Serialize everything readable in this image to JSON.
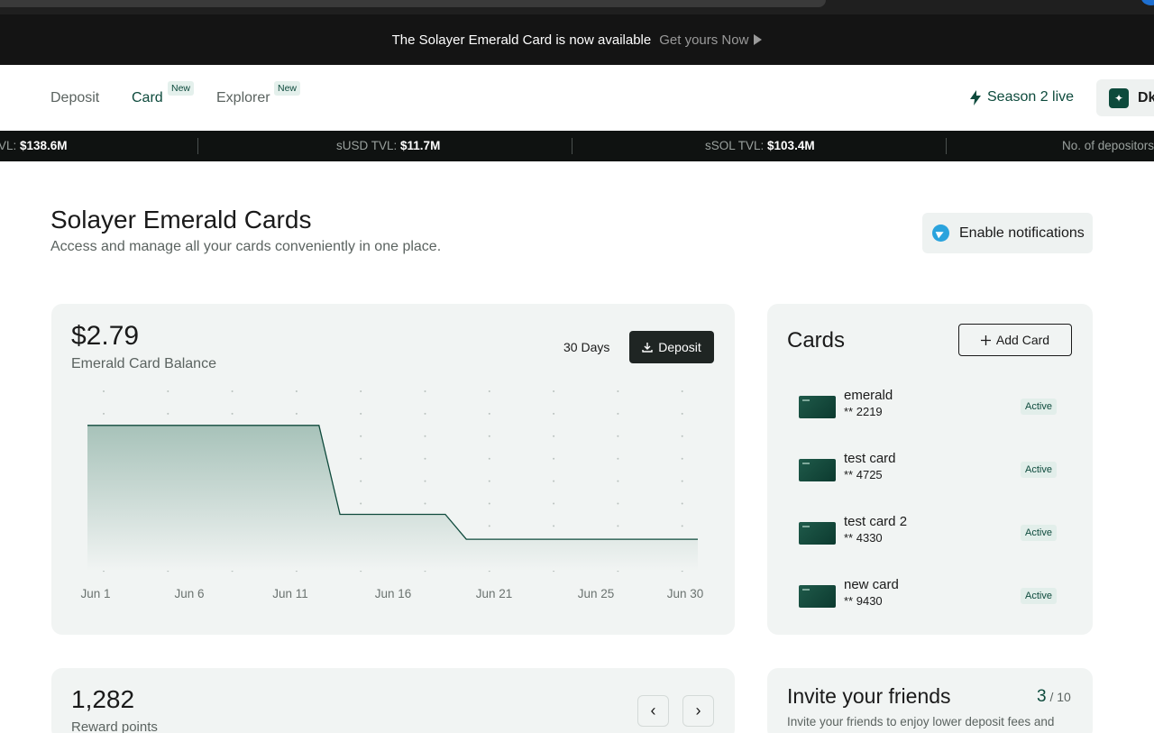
{
  "announcement": {
    "message": "The Solayer Emerald Card is now available",
    "link": "Get yours Now"
  },
  "nav": {
    "items": [
      {
        "label": "Deposit",
        "badge": ""
      },
      {
        "label": "Card",
        "badge": "New"
      },
      {
        "label": "Explorer",
        "badge": "New"
      }
    ],
    "season": "Season 2 live",
    "wallet_label": "Dk"
  },
  "ticker": [
    {
      "label": "VL: ",
      "value": "$138.6M"
    },
    {
      "label": "sUSD TVL: ",
      "value": "$11.7M"
    },
    {
      "label": "sSOL TVL: ",
      "value": "$103.4M"
    },
    {
      "label": "No. of depositors",
      "value": ""
    }
  ],
  "page": {
    "title": "Solayer Emerald Cards",
    "subtitle": "Access and manage all your cards conveniently in one place.",
    "notifications_button": "Enable notifications"
  },
  "balance": {
    "amount": "$2.79",
    "label": "Emerald Card Balance",
    "range": "30 Days",
    "deposit_button": "Deposit"
  },
  "chart_data": {
    "type": "area",
    "x": [
      "Jun 1",
      "Jun 2",
      "Jun 3",
      "Jun 4",
      "Jun 5",
      "Jun 6",
      "Jun 7",
      "Jun 8",
      "Jun 9",
      "Jun 10",
      "Jun 11",
      "Jun 12",
      "Jun 13",
      "Jun 14",
      "Jun 15",
      "Jun 16",
      "Jun 17",
      "Jun 18",
      "Jun 19",
      "Jun 20",
      "Jun 21",
      "Jun 22",
      "Jun 23",
      "Jun 24",
      "Jun 25",
      "Jun 26",
      "Jun 27",
      "Jun 28",
      "Jun 29",
      "Jun 30"
    ],
    "tick_labels": [
      "Jun 1",
      "Jun 6",
      "Jun 11",
      "Jun 16",
      "Jun 21",
      "Jun 25",
      "Jun 30"
    ],
    "tick_index": [
      0,
      5,
      10,
      15,
      20,
      24,
      29
    ],
    "values": [
      12.9,
      12.9,
      12.9,
      12.9,
      12.9,
      12.9,
      12.9,
      12.9,
      12.9,
      12.9,
      12.9,
      12.9,
      5.0,
      5.0,
      5.0,
      5.0,
      5.0,
      5.0,
      2.79,
      2.79,
      2.79,
      2.79,
      2.79,
      2.79,
      2.79,
      2.79,
      2.79,
      2.79,
      2.79,
      2.79
    ],
    "ylim": [
      0,
      16
    ],
    "grid": "dotted",
    "title": "",
    "xlabel": "",
    "ylabel": "",
    "colors": {
      "line": "#0f4a3c",
      "fill_top": "#a7c2b9",
      "fill_bottom": "#f1f4f3"
    }
  },
  "cards": {
    "title": "Cards",
    "add_button": "Add Card",
    "items": [
      {
        "name": "emerald",
        "number": "** 2219",
        "status": "Active"
      },
      {
        "name": "test card",
        "number": "** 4725",
        "status": "Active"
      },
      {
        "name": "test card 2",
        "number": "** 4330",
        "status": "Active"
      },
      {
        "name": "new card",
        "number": "** 9430",
        "status": "Active"
      }
    ]
  },
  "rewards": {
    "points": "1,282",
    "label": "Reward points",
    "prev": "‹",
    "next": "›"
  },
  "invite": {
    "title": "Invite your friends",
    "count": "3",
    "total": " / 10",
    "description": "Invite your friends to enjoy lower deposit fees and"
  },
  "icons": {
    "bolt": "bolt-icon",
    "wallet": "sparkle-icon",
    "telegram": "telegram-icon",
    "download": "download-icon",
    "plus": "plus-icon"
  }
}
